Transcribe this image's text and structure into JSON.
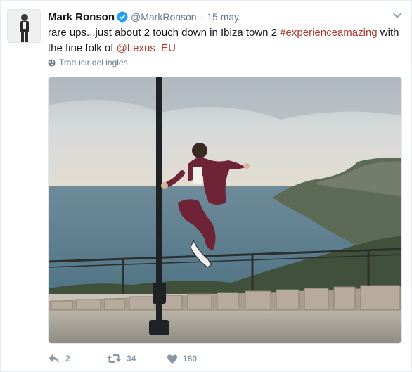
{
  "tweet": {
    "name": "Mark Ronson",
    "handle": "@MarkRonson",
    "separator": "·",
    "date": "15 may.",
    "text_parts": {
      "p1": "rare ups...just about 2 touch down in Ibiza town 2 ",
      "hashtag": "#experienceamazing",
      "p2": " with the fine folk of ",
      "mention": "@Lexus_EU"
    },
    "translate_label": "Traducir del inglés",
    "actions": {
      "replies": "2",
      "retweets": "34",
      "likes": "180"
    }
  },
  "icons": {
    "verified": "verified-badge-icon",
    "caret": "chevron-down-icon",
    "translate": "globe-icon",
    "reply": "reply-icon",
    "retweet": "retweet-icon",
    "like": "heart-icon"
  },
  "colors": {
    "link": "#ab3a2c",
    "verified": "#1da1f2",
    "muted": "#657786",
    "action": "#8899a6"
  }
}
